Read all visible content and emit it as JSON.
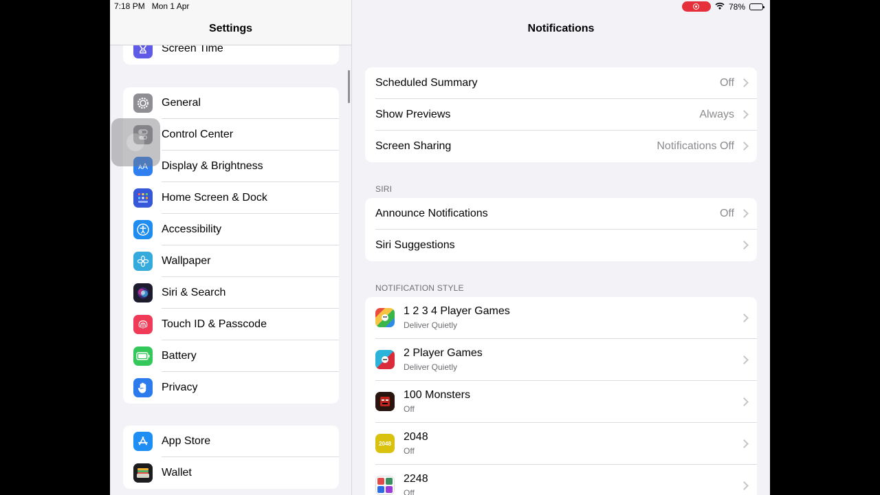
{
  "status_bar": {
    "time": "7:18 PM",
    "date": "Mon 1 Apr",
    "battery": "78%",
    "battery_level": 0.78
  },
  "sidebar": {
    "title": "Settings",
    "items": [
      {
        "label": "Screen Time",
        "icon": "hourglass-icon",
        "color": "#5e5ce6"
      },
      {
        "label": "General",
        "icon": "gear-icon",
        "color": "#8e8e93"
      },
      {
        "label": "Control Center",
        "icon": "toggles-icon",
        "color": "#8e8e93"
      },
      {
        "label": "Display & Brightness",
        "icon": "text-size-icon",
        "color": "#2f7ff0"
      },
      {
        "label": "Home Screen & Dock",
        "icon": "app-grid-icon",
        "color": "#3557d8"
      },
      {
        "label": "Accessibility",
        "icon": "accessibility-icon",
        "color": "#1f8cf0"
      },
      {
        "label": "Wallpaper",
        "icon": "flower-icon",
        "color": "#35aadc"
      },
      {
        "label": "Siri & Search",
        "icon": "siri-icon",
        "color": "#1c1c2e"
      },
      {
        "label": "Touch ID & Passcode",
        "icon": "fingerprint-icon",
        "color": "#ef3b58"
      },
      {
        "label": "Battery",
        "icon": "battery-icon",
        "color": "#34c759"
      },
      {
        "label": "Privacy",
        "icon": "hand-icon",
        "color": "#2b7bec"
      },
      {
        "label": "App Store",
        "icon": "app-store-icon",
        "color": "#1e8ef5"
      },
      {
        "label": "Wallet",
        "icon": "wallet-icon",
        "color": "#1c1c1e"
      }
    ]
  },
  "detail": {
    "title": "Notifications",
    "general": [
      {
        "label": "Scheduled Summary",
        "value": "Off"
      },
      {
        "label": "Show Previews",
        "value": "Always"
      },
      {
        "label": "Screen Sharing",
        "value": "Notifications Off"
      }
    ],
    "siri_header": "SIRI",
    "siri": [
      {
        "label": "Announce Notifications",
        "value": "Off"
      },
      {
        "label": "Siri Suggestions",
        "value": ""
      }
    ],
    "style_header": "NOTIFICATION STYLE",
    "apps": [
      {
        "name": "1 2 3 4 Player Games",
        "status": "Deliver Quietly",
        "icon": "player-games-icon",
        "color": "#e94b3c",
        "badge": ""
      },
      {
        "name": "2 Player Games",
        "status": "Deliver Quietly",
        "icon": "two-player-games-icon",
        "color": "#2bb3d9",
        "badge": ""
      },
      {
        "name": "100 Monsters",
        "status": "Off",
        "icon": "monster-icon",
        "color": "#2a1410",
        "badge": ""
      },
      {
        "name": "2048",
        "status": "Off",
        "icon": "tile-2048-icon",
        "color": "#d9c20f",
        "badge": "2048"
      },
      {
        "name": "2248",
        "status": "Off",
        "icon": "tile-2248-icon",
        "color": "#3a8f5e",
        "badge": ""
      }
    ]
  }
}
